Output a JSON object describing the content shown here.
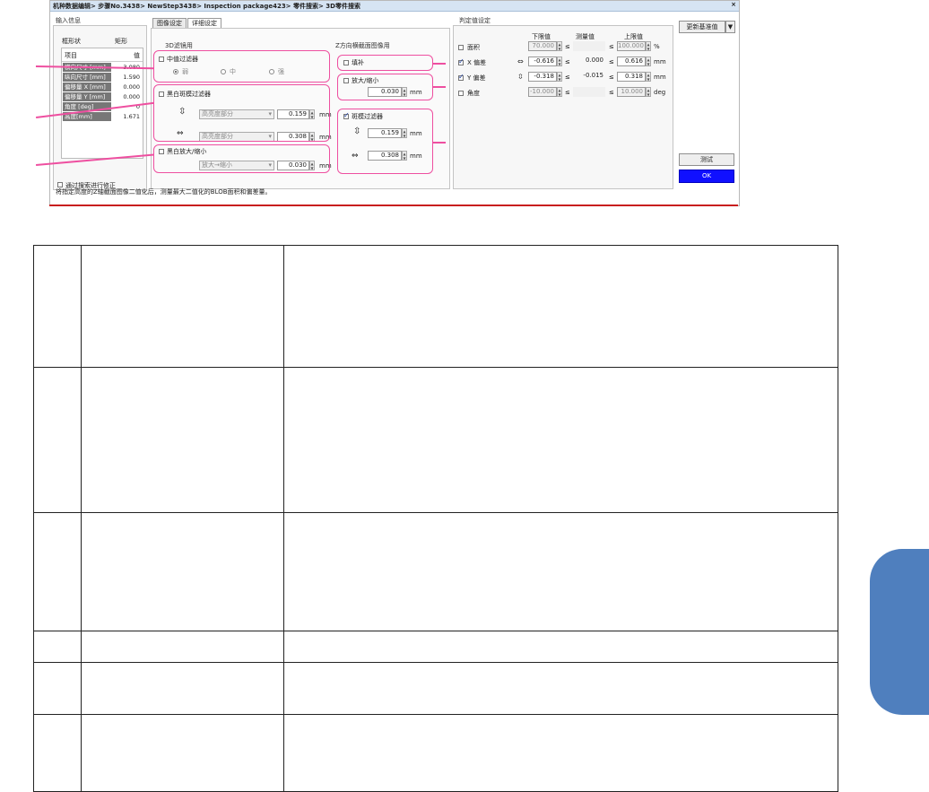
{
  "dialog": {
    "title": "机种数据编辑> 步骤No.3438> NewStep3438> Inspection package423> 零件搜索> 3D零件搜索",
    "close": "×",
    "status_text": "将指定高度的Z轴截面图像二值化后，测量最大二值化的BLOB面积和偏差量。"
  },
  "input_info": {
    "header": "输入信息",
    "shape_label": "框形状",
    "shape_value": "矩形",
    "col_item": "项目",
    "col_value": "值",
    "rows": [
      {
        "item": "横向尺寸 [mm]",
        "value": "3.080"
      },
      {
        "item": "纵向尺寸 [mm]",
        "value": "1.590"
      },
      {
        "item": "偏移量 X [mm]",
        "value": "0.000"
      },
      {
        "item": "偏移量 Y [mm]",
        "value": "0.000"
      },
      {
        "item": "角度 [deg]",
        "value": "0"
      },
      {
        "item": "高度[mm]",
        "value": "1.671"
      }
    ],
    "footer_checkbox": "通过搜索进行修正"
  },
  "tabs": [
    "图像设定",
    "详细设定"
  ],
  "filter3d": {
    "header": "3D滤镜用",
    "median": {
      "label": "中值过滤器",
      "options": [
        "弱",
        "中",
        "强"
      ]
    },
    "bw_noise": {
      "label": "黑白斑模过滤器",
      "sel1": "高亮度部分",
      "val1": "0.159",
      "sel2": "高亮度部分",
      "val2": "0.308",
      "unit": "mm"
    },
    "bw_expand": {
      "label": "黑白放大/缩小",
      "sel": "放大→缩小",
      "val": "0.030",
      "unit": "mm"
    }
  },
  "zsection": {
    "header": "Z方向横截面图像用",
    "fill_label": "填补",
    "expand_label": "放大/缩小",
    "expand_val": "0.030",
    "noise_label": "斑模过滤器",
    "noise_val1": "0.159",
    "noise_val2": "0.308",
    "unit": "mm"
  },
  "judge": {
    "header": "判定值设定",
    "col_lower": "下限值",
    "col_measured": "测量值",
    "col_upper": "上限值",
    "rows": [
      {
        "label": "面积",
        "lower": "70.000",
        "measured": "",
        "upper": "100.000",
        "unit": "%",
        "checked": false
      },
      {
        "label": "X 偏差",
        "lower": "-0.616",
        "measured": "0.000",
        "upper": "0.616",
        "unit": "mm",
        "checked": true
      },
      {
        "label": "Y 偏差",
        "lower": "-0.318",
        "measured": "-0.015",
        "upper": "0.318",
        "unit": "mm",
        "checked": true
      },
      {
        "label": "角度",
        "lower": "-10.000",
        "measured": "",
        "upper": "10.000",
        "unit": "deg",
        "checked": false
      }
    ],
    "cmp": "≤"
  },
  "right_buttons": {
    "update": "更新基准值",
    "test": "测试",
    "ok": "OK"
  },
  "colors": {
    "callout": "#ee4fa0",
    "ok": "#1010ff",
    "side_tab": "#4f7fbe"
  }
}
